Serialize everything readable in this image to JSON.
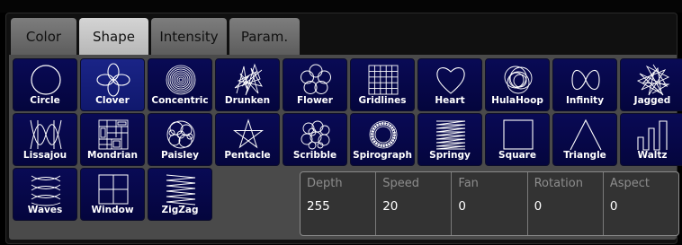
{
  "tabs": [
    {
      "label": "Color",
      "active": false
    },
    {
      "label": "Shape",
      "active": true
    },
    {
      "label": "Intensity",
      "active": false
    },
    {
      "label": "Param.",
      "active": false
    }
  ],
  "shapes": [
    {
      "label": "Circle",
      "icon": "circle-icon"
    },
    {
      "label": "Clover",
      "icon": "clover-icon",
      "selected": true
    },
    {
      "label": "Concentric",
      "icon": "concentric-icon"
    },
    {
      "label": "Drunken",
      "icon": "drunken-icon"
    },
    {
      "label": "Flower",
      "icon": "flower-icon"
    },
    {
      "label": "Gridlines",
      "icon": "gridlines-icon"
    },
    {
      "label": "Heart",
      "icon": "heart-icon"
    },
    {
      "label": "HulaHoop",
      "icon": "hulahoop-icon"
    },
    {
      "label": "Infinity",
      "icon": "infinity-icon"
    },
    {
      "label": "Jagged",
      "icon": "jagged-icon"
    },
    {
      "label": "Lissajou",
      "icon": "lissajou-icon"
    },
    {
      "label": "Mondrian",
      "icon": "mondrian-icon"
    },
    {
      "label": "Paisley",
      "icon": "paisley-icon"
    },
    {
      "label": "Pentacle",
      "icon": "pentacle-icon"
    },
    {
      "label": "Scribble",
      "icon": "scribble-icon"
    },
    {
      "label": "Spirograph",
      "icon": "spirograph-icon"
    },
    {
      "label": "Springy",
      "icon": "springy-icon"
    },
    {
      "label": "Square",
      "icon": "square-icon"
    },
    {
      "label": "Triangle",
      "icon": "triangle-icon"
    },
    {
      "label": "Waltz",
      "icon": "waltz-icon"
    },
    {
      "label": "Waves",
      "icon": "waves-icon"
    },
    {
      "label": "Window",
      "icon": "window-icon"
    },
    {
      "label": "ZigZag",
      "icon": "zigzag-icon"
    }
  ],
  "params": [
    {
      "label": "Depth",
      "value": "255"
    },
    {
      "label": "Speed",
      "value": "20"
    },
    {
      "label": "Fan",
      "value": "0"
    },
    {
      "label": "Rotation",
      "value": "0"
    },
    {
      "label": "Aspect",
      "value": "0"
    }
  ],
  "colors": {
    "tile": "#060748",
    "tile_selected": "#1a2487",
    "tab_active": "#c6c6c6",
    "tab_inactive": "#6c6c6c",
    "icon_stroke": "#ffffff"
  }
}
